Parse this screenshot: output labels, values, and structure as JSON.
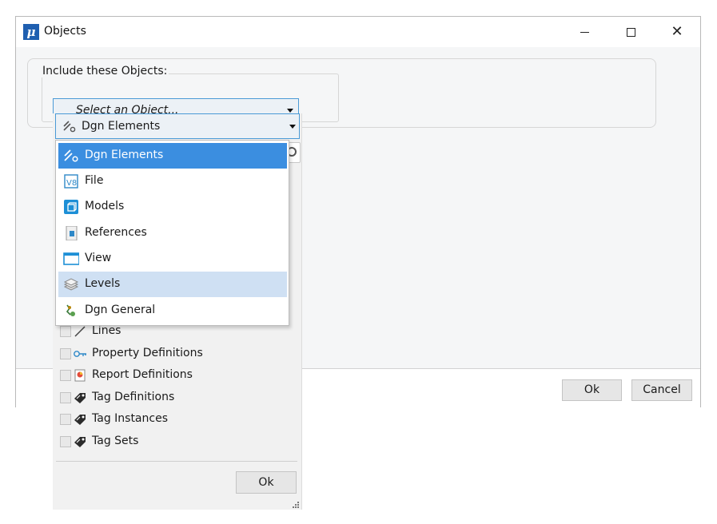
{
  "window": {
    "title": "Objects"
  },
  "group": {
    "legend": "Include these Objects:"
  },
  "object_select": {
    "placeholder": "Select an Object..."
  },
  "popup": {
    "type_select": {
      "value": "Dgn Elements"
    },
    "dropdown": {
      "items": [
        {
          "label": "Dgn Elements",
          "icon": "dgn-elements-icon",
          "state": "selected"
        },
        {
          "label": "File",
          "icon": "file-v8-icon",
          "state": ""
        },
        {
          "label": "Models",
          "icon": "models-icon",
          "state": ""
        },
        {
          "label": "References",
          "icon": "references-icon",
          "state": ""
        },
        {
          "label": "View",
          "icon": "view-icon",
          "state": ""
        },
        {
          "label": "Levels",
          "icon": "levels-icon",
          "state": "hover"
        },
        {
          "label": "Dgn General",
          "icon": "dgn-general-icon",
          "state": ""
        }
      ]
    },
    "checklist": [
      {
        "label": "Lines",
        "icon": "line-icon",
        "checked": false
      },
      {
        "label": "Property Definitions",
        "icon": "key-icon",
        "checked": false
      },
      {
        "label": "Report Definitions",
        "icon": "report-icon",
        "checked": false
      },
      {
        "label": "Tag Definitions",
        "icon": "tag-icon",
        "checked": false
      },
      {
        "label": "Tag Instances",
        "icon": "tag-icon",
        "checked": false
      },
      {
        "label": "Tag Sets",
        "icon": "tag-icon",
        "checked": false
      }
    ],
    "ok_label": "Ok"
  },
  "footer": {
    "ok_label": "Ok",
    "cancel_label": "Cancel"
  },
  "colors": {
    "accent": "#3b8ee0",
    "hover": "#cfe0f3",
    "logo": "#1f5fb0"
  }
}
